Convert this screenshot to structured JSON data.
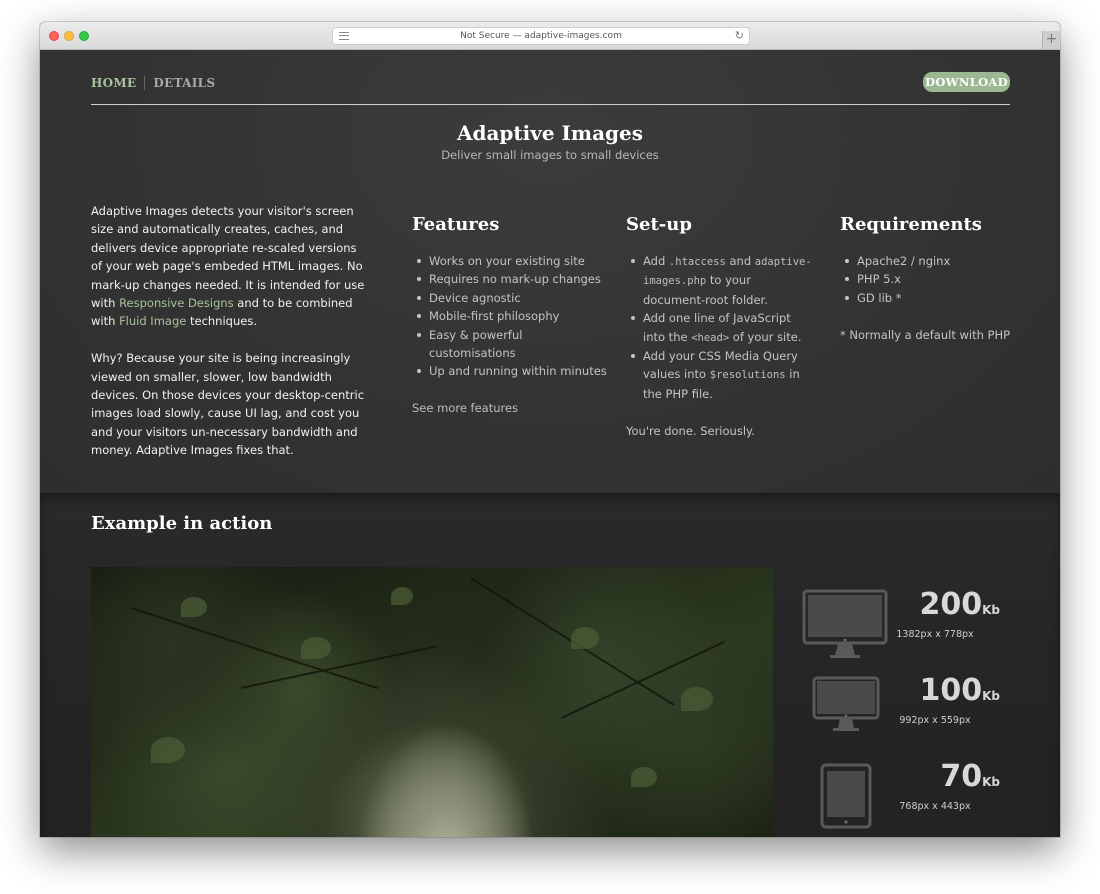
{
  "browser": {
    "url_text": "Not Secure — adaptive-images.com",
    "new_tab": "+",
    "reload": "↻"
  },
  "nav": {
    "home": "HOME",
    "details": "DETAILS",
    "download": "DOWNLOAD"
  },
  "header": {
    "title": "Adaptive Images",
    "subtitle": "Deliver small images to small devices"
  },
  "intro": {
    "p1_a": "Adaptive Images detects your visitor's screen size and automatically creates, caches, and delivers device appropriate re-scaled versions of your web page's embeded HTML images. No mark-up changes needed. It is intended for use with ",
    "link1": "Responsive Designs",
    "p1_b": " and to be combined with ",
    "link2": "Fluid Image",
    "p1_c": " techniques.",
    "p2": "Why? Because your site is being increasingly viewed on smaller, slower, low bandwidth devices. On those devices your desktop-centric images load slowly, cause UI lag, and cost you and your visitors un-necessary bandwidth and money. Adaptive Images fixes that."
  },
  "features": {
    "title": "Features",
    "items": [
      "Works on your existing site",
      "Requires no mark-up changes",
      "Device agnostic",
      "Mobile-first philosophy",
      "Easy & powerful customisations",
      "Up and running within minutes"
    ],
    "more": "See more features"
  },
  "setup": {
    "title": "Set-up",
    "i1_a": "Add ",
    "i1_code1": ".htaccess",
    "i1_b": " and ",
    "i1_code2": "adaptive-images.php",
    "i1_c": " to your document-root folder.",
    "i2_a": "Add one line of JavaScript into the ",
    "i2_code": "<head>",
    "i2_b": " of your site.",
    "i3_a": "Add your CSS Media Query values into ",
    "i3_code": "$resolutions",
    "i3_b": " in the PHP file.",
    "done": "You're done. Seriously."
  },
  "requirements": {
    "title": "Requirements",
    "items": [
      "Apache2 / nginx",
      "PHP 5.x",
      "GD lib *"
    ],
    "note": "* Normally a default with PHP"
  },
  "example": {
    "title": "Example in action",
    "stats": [
      {
        "device": "desktop-large",
        "size": "200",
        "unit": "Kb",
        "dims": "1382px x 778px"
      },
      {
        "device": "desktop-small",
        "size": "100",
        "unit": "Kb",
        "dims": "992px x 559px"
      },
      {
        "device": "tablet",
        "size": "70",
        "unit": "Kb",
        "dims": "768px x 443px"
      }
    ]
  },
  "colors": {
    "accent": "#9cb892",
    "link": "#a9c39c",
    "background": "#333333"
  }
}
